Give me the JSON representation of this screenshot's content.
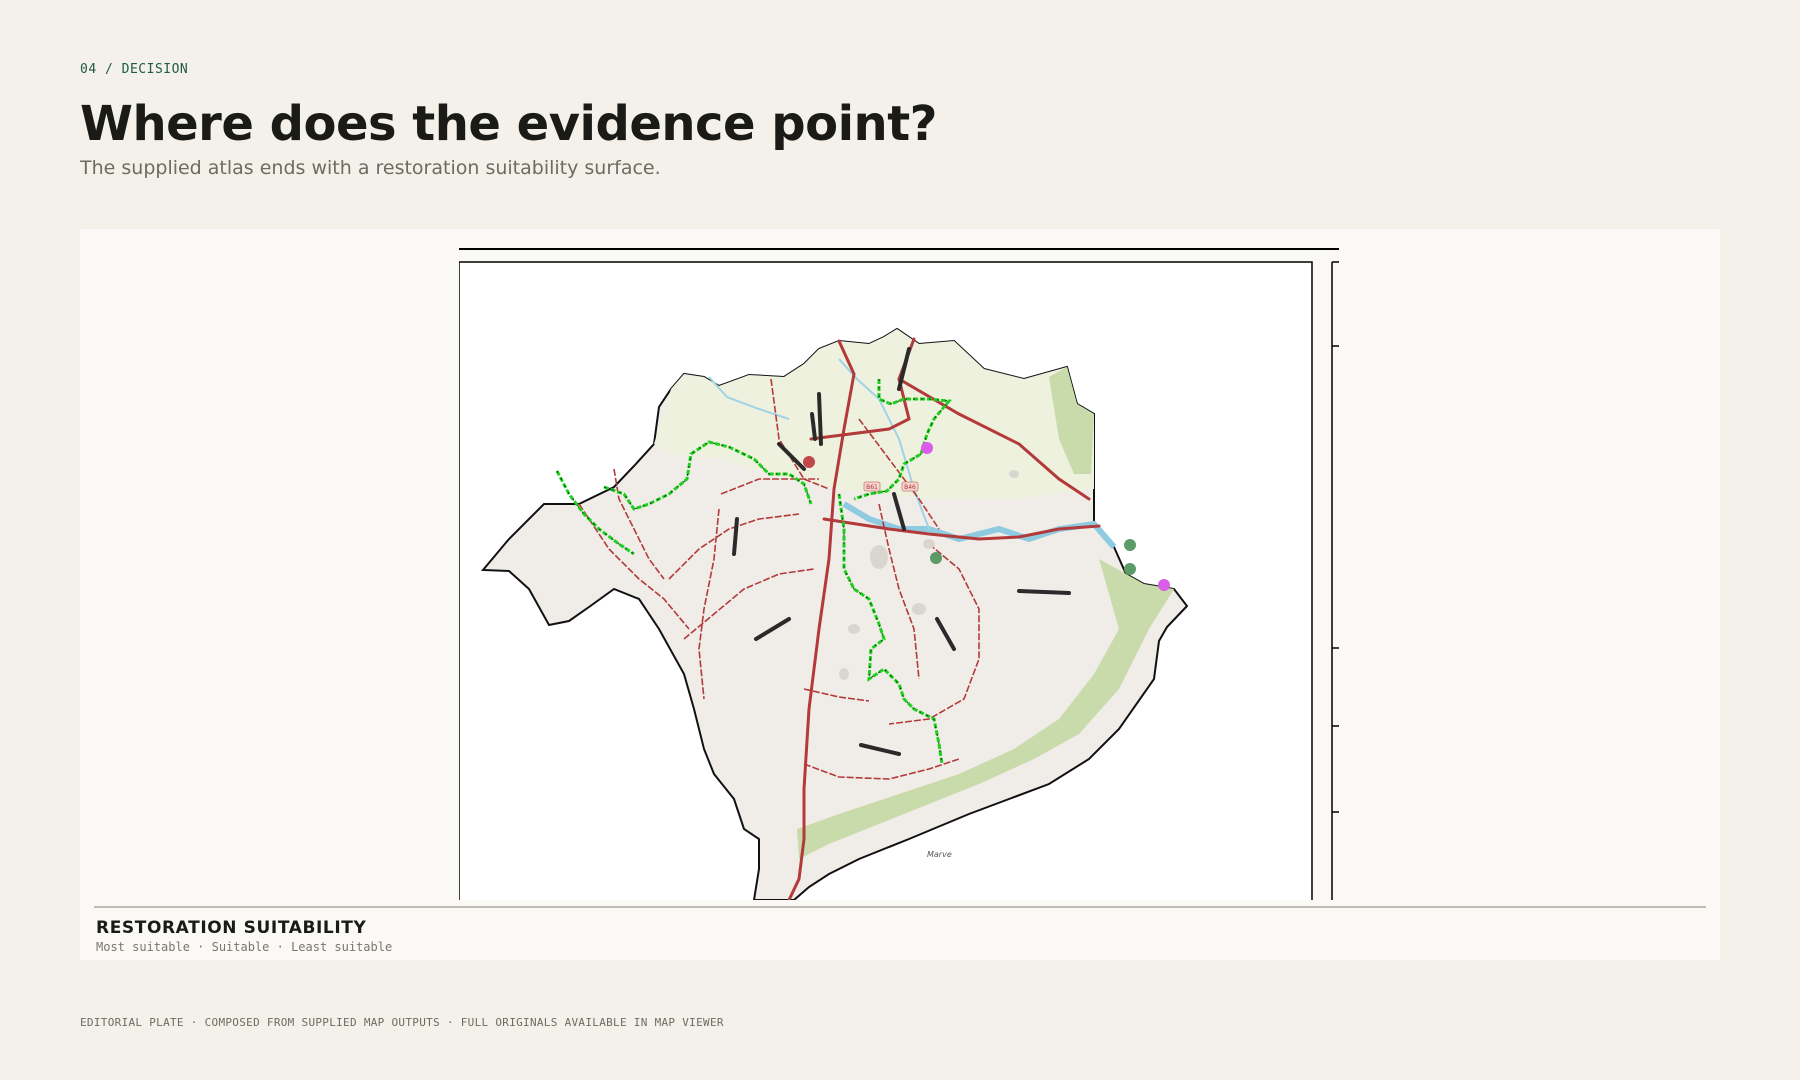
{
  "header": {
    "kicker": "04 / DECISION",
    "title": "Where does the evidence point?",
    "subtitle": "The supplied atlas ends with a restoration suitability surface."
  },
  "map": {
    "place_label": "Marve",
    "road_badges": [
      "B61",
      "B46"
    ],
    "colors": {
      "roads": "#b33a3a",
      "route": "#1fcf1f",
      "boundary": "#111111",
      "water": "#8fcbe0",
      "woodland": "#c9dbaa",
      "farmland": "#eef1dd",
      "urban": "#f0ede8"
    },
    "markers": [
      {
        "category": "Least suitable",
        "color": "#c0474a"
      },
      {
        "category": "Suitable",
        "color": "#d95de8"
      },
      {
        "category": "Most suitable",
        "color": "#5c9a68"
      }
    ]
  },
  "caption": {
    "title": "RESTORATION SUITABILITY",
    "legend": "Most suitable · Suitable · Least suitable"
  },
  "footer": "EDITORIAL PLATE · COMPOSED FROM SUPPLIED MAP OUTPUTS · FULL ORIGINALS AVAILABLE IN MAP VIEWER"
}
